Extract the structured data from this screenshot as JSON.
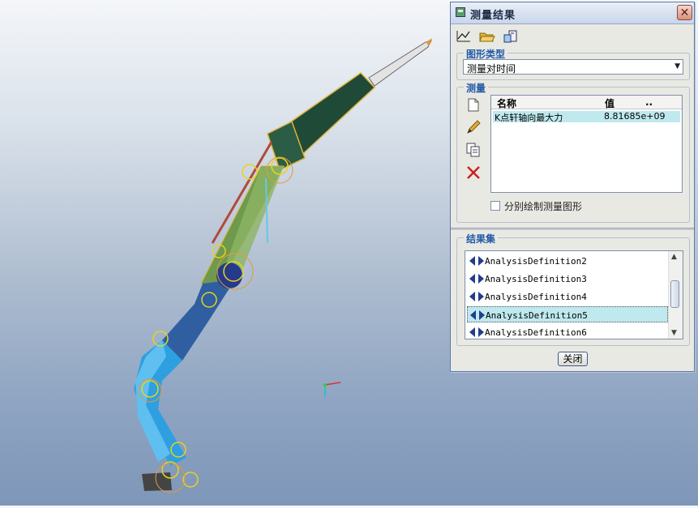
{
  "dialog": {
    "title": "测量结果",
    "close_glyph": "✕",
    "toolbar": [
      "chart-icon",
      "open-folder-icon",
      "export-icon"
    ],
    "graph_type": {
      "label": "图形类型",
      "selected": "测量对时间",
      "dropdown_glyph": "▼"
    },
    "measures": {
      "label": "测量",
      "side_buttons": [
        "new-document-icon",
        "edit-pencil-icon",
        "copy-icon",
        "delete-x-icon"
      ],
      "columns": [
        "名称",
        "值",
        ".."
      ],
      "rows": [
        {
          "name": "K点轩轴向最大力",
          "value": "8.81685e+09"
        }
      ],
      "separate_plot_label": "分别绘制测量图形"
    },
    "result_sets": {
      "label": "结果集",
      "items": [
        "AnalysisDefinition2",
        "AnalysisDefinition3",
        "AnalysisDefinition4",
        "AnalysisDefinition5",
        "AnalysisDefinition6"
      ],
      "selected_index": 3
    },
    "close_button_label": "关闭"
  },
  "viewport": {
    "background_colors": [
      "#f4f6f9",
      "#7e96b8"
    ],
    "model": "excavator-arm-mechanism"
  }
}
